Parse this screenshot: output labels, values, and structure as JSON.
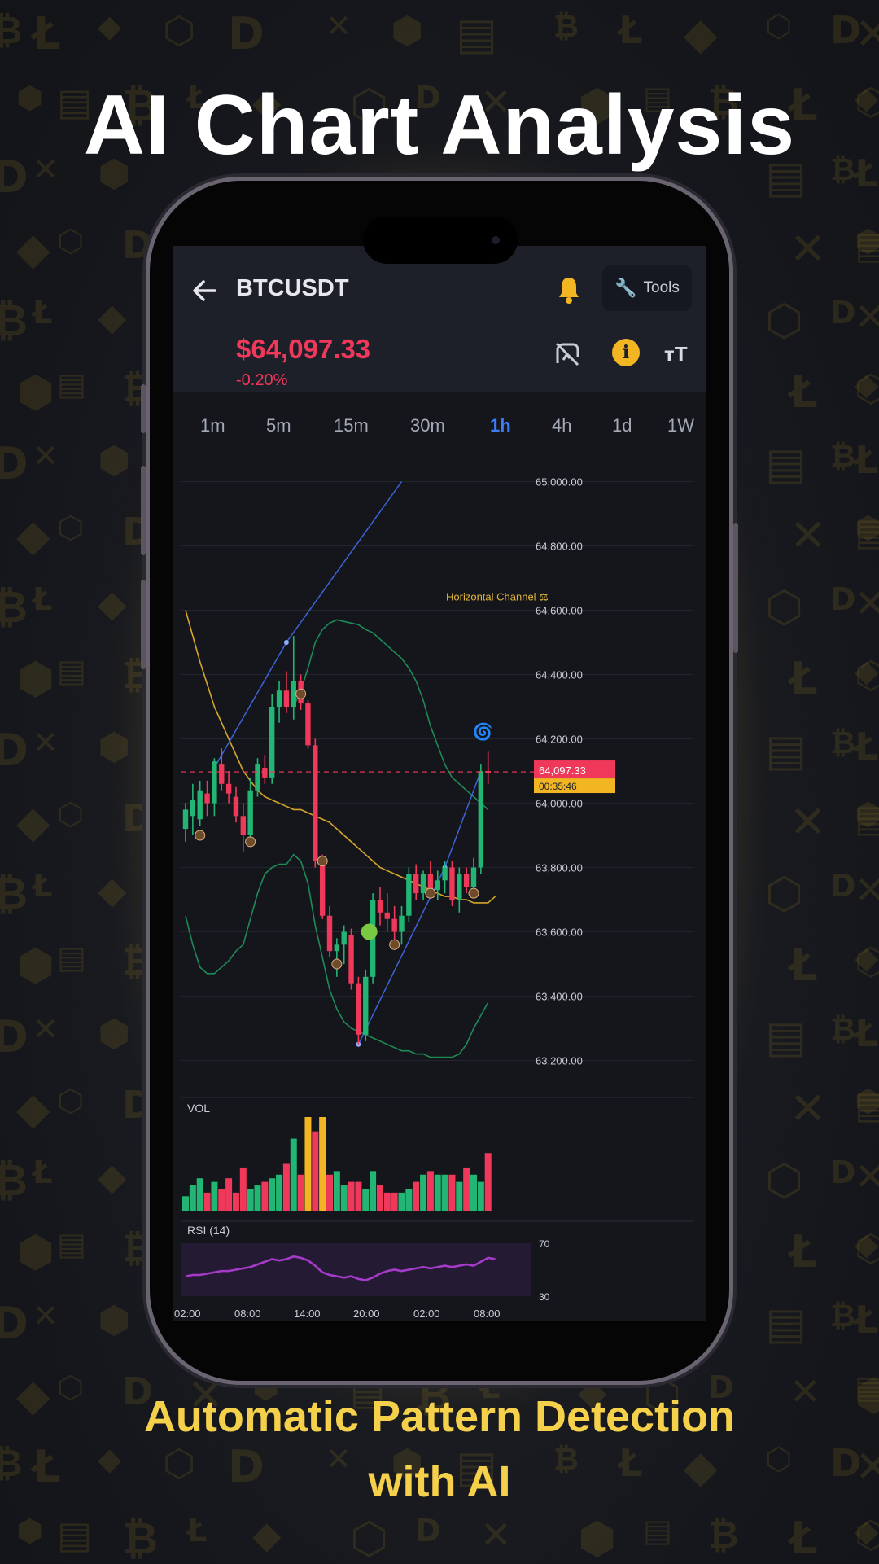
{
  "headline": "AI Chart Analysis",
  "subline_1": "Automatic Pattern Detection",
  "subline_2": "with AI",
  "header": {
    "symbol": "BTCUSDT",
    "tools_label": "Tools",
    "price": "$64,097.33",
    "change": "-0.20%"
  },
  "timeframes": [
    "1m",
    "5m",
    "15m",
    "30m",
    "1h",
    "4h",
    "1d",
    "1W"
  ],
  "active_timeframe": "1h",
  "annotation": "Horizontal Channel ⚖",
  "price_tag": "64,097.33",
  "countdown_tag": "00:35:46",
  "volume_label": "VOL",
  "rsi_label": "RSI (14)",
  "rsi_levels": [
    "70",
    "30"
  ],
  "price_ticks": [
    "65,000.00",
    "64,800.00",
    "64,600.00",
    "64,400.00",
    "64,200.00",
    "64,000.00",
    "63,800.00",
    "63,600.00",
    "63,400.00",
    "63,200.00"
  ],
  "time_ticks": [
    "02:00",
    "08:00",
    "14:00",
    "20:00",
    "02:00",
    "08:00"
  ],
  "colors": {
    "bull": "#22b573",
    "bear": "#f0385a",
    "accent": "#f5d04a",
    "active_tab": "#3d7bf7",
    "rsi": "#a63bc9"
  },
  "chart_data": {
    "type": "candlestick",
    "ylim": [
      63100,
      65100
    ],
    "candles": [
      {
        "o": 63920,
        "h": 64000,
        "l": 63880,
        "c": 63980
      },
      {
        "o": 63960,
        "h": 64060,
        "l": 63900,
        "c": 64010
      },
      {
        "o": 63950,
        "h": 64070,
        "l": 63930,
        "c": 64040
      },
      {
        "o": 64030,
        "h": 64070,
        "l": 63960,
        "c": 64000
      },
      {
        "o": 64000,
        "h": 64140,
        "l": 63960,
        "c": 64130
      },
      {
        "o": 64120,
        "h": 64170,
        "l": 64040,
        "c": 64060
      },
      {
        "o": 64060,
        "h": 64100,
        "l": 64000,
        "c": 64030
      },
      {
        "o": 64020,
        "h": 64050,
        "l": 63940,
        "c": 63960
      },
      {
        "o": 63960,
        "h": 64000,
        "l": 63850,
        "c": 63900
      },
      {
        "o": 63900,
        "h": 64080,
        "l": 63880,
        "c": 64040
      },
      {
        "o": 64040,
        "h": 64140,
        "l": 64020,
        "c": 64120
      },
      {
        "o": 64110,
        "h": 64150,
        "l": 64060,
        "c": 64080
      },
      {
        "o": 64080,
        "h": 64340,
        "l": 64060,
        "c": 64300
      },
      {
        "o": 64300,
        "h": 64380,
        "l": 64250,
        "c": 64350
      },
      {
        "o": 64350,
        "h": 64410,
        "l": 64280,
        "c": 64300
      },
      {
        "o": 64300,
        "h": 64520,
        "l": 64260,
        "c": 64380
      },
      {
        "o": 64380,
        "h": 64400,
        "l": 64290,
        "c": 64310
      },
      {
        "o": 64310,
        "h": 64320,
        "l": 64170,
        "c": 64180
      },
      {
        "o": 64180,
        "h": 64200,
        "l": 63800,
        "c": 63820
      },
      {
        "o": 63820,
        "h": 63840,
        "l": 63640,
        "c": 63650
      },
      {
        "o": 63650,
        "h": 63680,
        "l": 63520,
        "c": 63540
      },
      {
        "o": 63540,
        "h": 63580,
        "l": 63460,
        "c": 63560
      },
      {
        "o": 63560,
        "h": 63620,
        "l": 63500,
        "c": 63600
      },
      {
        "o": 63590,
        "h": 63610,
        "l": 63420,
        "c": 63440
      },
      {
        "o": 63440,
        "h": 63460,
        "l": 63250,
        "c": 63280
      },
      {
        "o": 63280,
        "h": 63480,
        "l": 63260,
        "c": 63460
      },
      {
        "o": 63460,
        "h": 63720,
        "l": 63440,
        "c": 63700
      },
      {
        "o": 63700,
        "h": 63740,
        "l": 63620,
        "c": 63660
      },
      {
        "o": 63660,
        "h": 63720,
        "l": 63600,
        "c": 63640
      },
      {
        "o": 63640,
        "h": 63680,
        "l": 63560,
        "c": 63600
      },
      {
        "o": 63600,
        "h": 63680,
        "l": 63560,
        "c": 63650
      },
      {
        "o": 63650,
        "h": 63800,
        "l": 63630,
        "c": 63780
      },
      {
        "o": 63780,
        "h": 63810,
        "l": 63700,
        "c": 63720
      },
      {
        "o": 63720,
        "h": 63790,
        "l": 63700,
        "c": 63780
      },
      {
        "o": 63780,
        "h": 63820,
        "l": 63710,
        "c": 63730
      },
      {
        "o": 63730,
        "h": 63790,
        "l": 63700,
        "c": 63760
      },
      {
        "o": 63760,
        "h": 63820,
        "l": 63720,
        "c": 63800
      },
      {
        "o": 63800,
        "h": 63820,
        "l": 63680,
        "c": 63700
      },
      {
        "o": 63700,
        "h": 63800,
        "l": 63660,
        "c": 63780
      },
      {
        "o": 63780,
        "h": 63800,
        "l": 63720,
        "c": 63740
      },
      {
        "o": 63740,
        "h": 63830,
        "l": 63720,
        "c": 63800
      },
      {
        "o": 63800,
        "h": 64120,
        "l": 63780,
        "c": 64100
      },
      {
        "o": 64100,
        "h": 64160,
        "l": 64060,
        "c": 64097
      }
    ],
    "volume": [
      4,
      7,
      9,
      5,
      8,
      6,
      9,
      5,
      12,
      6,
      7,
      8,
      9,
      10,
      13,
      20,
      10,
      26,
      22,
      26,
      10,
      11,
      7,
      8,
      8,
      6,
      11,
      7,
      5,
      5,
      5,
      6,
      8,
      10,
      11,
      10,
      10,
      10,
      8,
      12,
      10,
      8,
      16
    ],
    "rsi": [
      45,
      46,
      46,
      47,
      48,
      49,
      49,
      50,
      51,
      52,
      54,
      56,
      58,
      57,
      58,
      60,
      59,
      57,
      53,
      48,
      46,
      45,
      44,
      45,
      43,
      42,
      44,
      47,
      49,
      50,
      49,
      50,
      51,
      52,
      51,
      52,
      53,
      52,
      53,
      54,
      53,
      56,
      59,
      58
    ],
    "bollinger_upper": [
      null,
      null,
      null,
      null,
      null,
      null,
      null,
      null,
      null,
      null,
      null,
      null,
      null,
      null,
      null,
      64300,
      64350,
      64420,
      64500,
      64540,
      64560,
      64570,
      64565,
      64560,
      64555,
      64540,
      64530,
      64510,
      64490,
      64470,
      64450,
      64420,
      64380,
      64320,
      64240,
      64180,
      64120,
      64080,
      64060,
      64040,
      64020,
      64000,
      63980
    ],
    "bollinger_lower": [
      63650,
      63560,
      63490,
      63470,
      63470,
      63490,
      63510,
      63540,
      63560,
      63640,
      63720,
      63780,
      63800,
      63810,
      63810,
      63840,
      63820,
      63750,
      63620,
      63520,
      63420,
      63360,
      63320,
      63300,
      63290,
      63280,
      63270,
      63260,
      63250,
      63240,
      63230,
      63230,
      63220,
      63220,
      63210,
      63210,
      63210,
      63210,
      63220,
      63250,
      63300,
      63340,
      63380
    ],
    "ma": [
      64600,
      64520,
      64440,
      64370,
      64300,
      64250,
      64200,
      64150,
      64100,
      64070,
      64040,
      64020,
      64010,
      64000,
      63990,
      63980,
      63980,
      63970,
      63960,
      63950,
      63940,
      63920,
      63900,
      63880,
      63860,
      63840,
      63820,
      63800,
      63790,
      63780,
      63770,
      63760,
      63750,
      63740,
      63730,
      63720,
      63710,
      63710,
      63700,
      63700,
      63690,
      63690,
      63690,
      63710
    ],
    "trendlines": [
      {
        "from": [
          4,
          64110
        ],
        "to": [
          14,
          64500
        ]
      },
      {
        "from": [
          14,
          64500
        ],
        "to": [
          30,
          65000
        ]
      },
      {
        "from": [
          24,
          63250
        ],
        "to": [
          36,
          63800
        ]
      },
      {
        "from": [
          36,
          63800
        ],
        "to": [
          41,
          64100
        ]
      }
    ]
  }
}
